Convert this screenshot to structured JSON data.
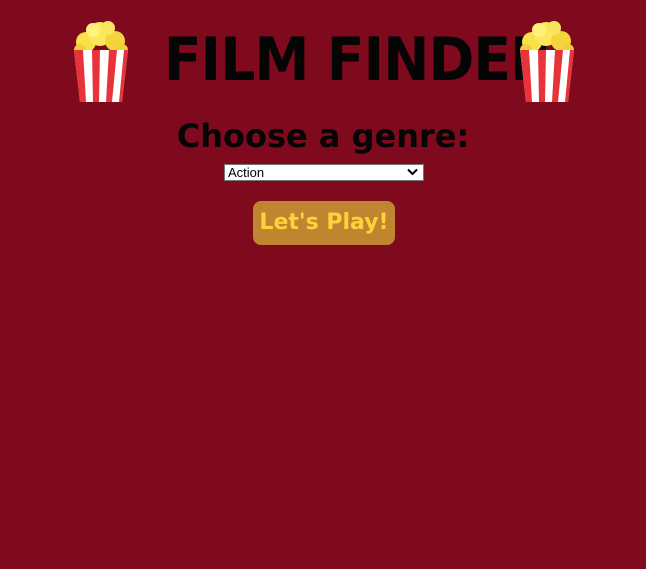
{
  "header": {
    "title": "FILM FINDER",
    "left_icon": "popcorn-icon",
    "right_icon": "popcorn-icon"
  },
  "genre": {
    "prompt": "Choose a genre:",
    "selected": "Action"
  },
  "play_button": {
    "label": "Let's Play!"
  },
  "colors": {
    "background": "#7f0a1e",
    "title": "#050505",
    "button_bg": "#c0862f",
    "button_text": "#ffd23a"
  }
}
